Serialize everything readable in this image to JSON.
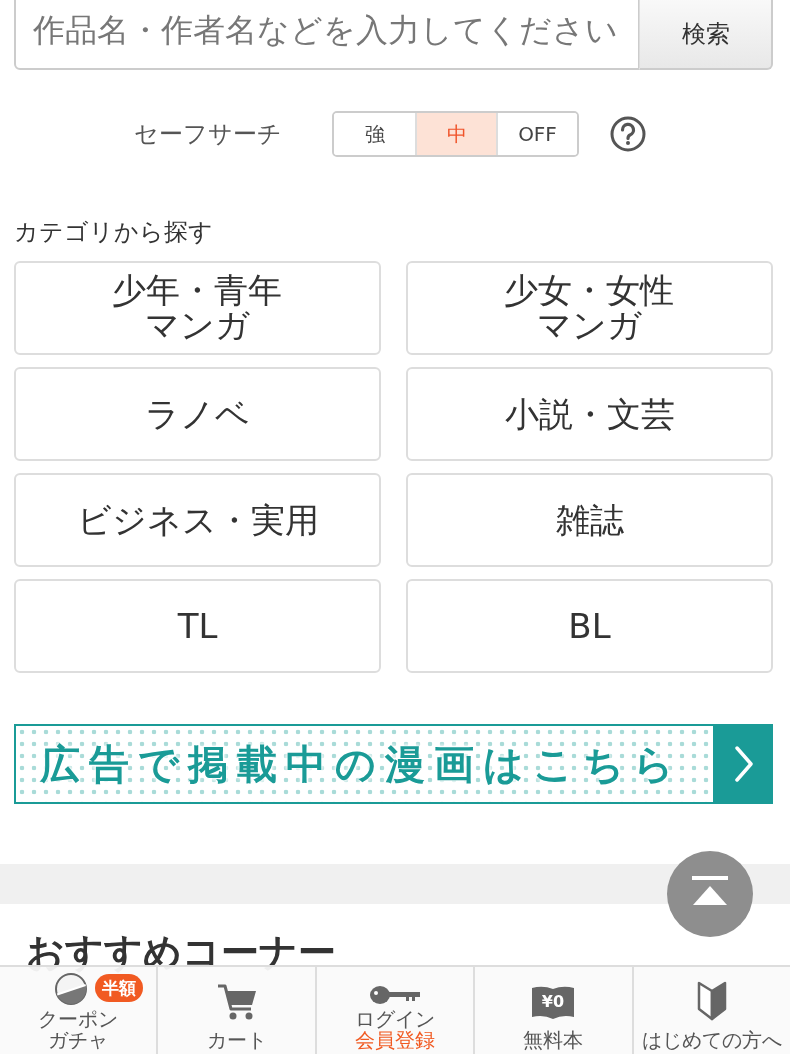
{
  "search": {
    "placeholder": "作品名・作者名などを入力してください",
    "button": "検索"
  },
  "safe_search": {
    "label": "セーフサーチ",
    "options": [
      {
        "label": "強",
        "selected": false
      },
      {
        "label": "中",
        "selected": true
      },
      {
        "label": "OFF",
        "selected": false
      }
    ]
  },
  "categories": {
    "title": "カテゴリから探す",
    "items": [
      {
        "label": "少年・青年マンガ"
      },
      {
        "label": "少女・女性マンガ"
      },
      {
        "label": "ラノベ"
      },
      {
        "label": "小説・文芸"
      },
      {
        "label": "ビジネス・実用"
      },
      {
        "label": "雑誌"
      },
      {
        "label": "TL"
      },
      {
        "label": "BL"
      }
    ]
  },
  "banner": {
    "text": "広告で掲載中の漫画はこちら"
  },
  "recommend": {
    "title": "おすすめコーナー"
  },
  "bottom_nav": [
    {
      "kind": "gacha",
      "label": "クーポンガチャ",
      "badge": "半額"
    },
    {
      "kind": "cart",
      "label": "カート"
    },
    {
      "kind": "login",
      "label": "ログイン",
      "sublabel": "会員登録"
    },
    {
      "kind": "free",
      "label": "無料本",
      "icon_text": "¥0"
    },
    {
      "kind": "beginner",
      "label": "はじめての方へ"
    }
  ]
}
